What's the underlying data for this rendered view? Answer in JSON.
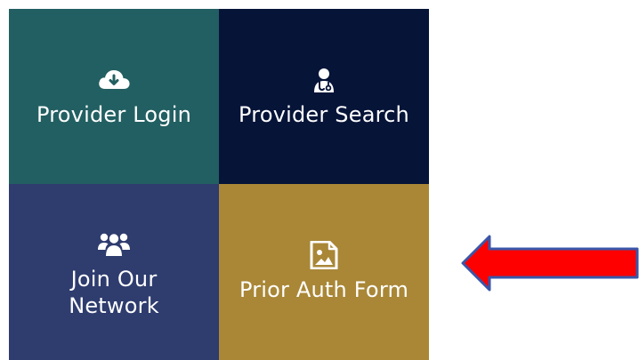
{
  "tiles": [
    {
      "label": "Provider Login",
      "icon": "cloud-download-icon",
      "background": "#225f62"
    },
    {
      "label": "Provider Search",
      "icon": "doctor-stethoscope-icon",
      "background": "#061438"
    },
    {
      "label": "Join Our\nNetwork",
      "icon": "users-group-icon",
      "background": "#2e3c6e"
    },
    {
      "label": "Prior Auth Form",
      "icon": "image-file-icon",
      "background": "#a98737"
    }
  ],
  "annotation": {
    "arrow_icon": "left-arrow-icon",
    "arrow_fill": "#ff0000",
    "arrow_stroke": "#3a56a8"
  }
}
